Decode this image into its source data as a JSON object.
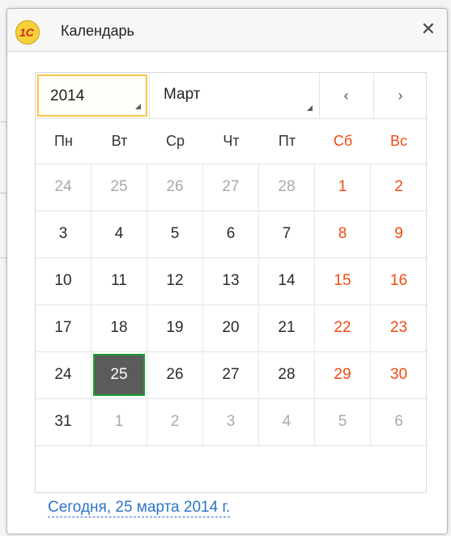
{
  "window": {
    "title": "Календарь",
    "close_symbol": "✕",
    "logo_text": "1C"
  },
  "calendar": {
    "year": "2014",
    "month": "Март",
    "prev_symbol": "‹",
    "next_symbol": "›",
    "weekdays": [
      {
        "label": "Пн",
        "weekend": false
      },
      {
        "label": "Вт",
        "weekend": false
      },
      {
        "label": "Ср",
        "weekend": false
      },
      {
        "label": "Чт",
        "weekend": false
      },
      {
        "label": "Пт",
        "weekend": false
      },
      {
        "label": "Сб",
        "weekend": true
      },
      {
        "label": "Вс",
        "weekend": true
      }
    ],
    "weeks": [
      [
        {
          "d": "24",
          "o": true
        },
        {
          "d": "25",
          "o": true
        },
        {
          "d": "26",
          "o": true
        },
        {
          "d": "27",
          "o": true
        },
        {
          "d": "28",
          "o": true
        },
        {
          "d": "1",
          "w": true
        },
        {
          "d": "2",
          "w": true
        }
      ],
      [
        {
          "d": "3"
        },
        {
          "d": "4"
        },
        {
          "d": "5"
        },
        {
          "d": "6"
        },
        {
          "d": "7"
        },
        {
          "d": "8",
          "w": true
        },
        {
          "d": "9",
          "w": true
        }
      ],
      [
        {
          "d": "10"
        },
        {
          "d": "11"
        },
        {
          "d": "12"
        },
        {
          "d": "13"
        },
        {
          "d": "14"
        },
        {
          "d": "15",
          "w": true
        },
        {
          "d": "16",
          "w": true
        }
      ],
      [
        {
          "d": "17"
        },
        {
          "d": "18"
        },
        {
          "d": "19"
        },
        {
          "d": "20"
        },
        {
          "d": "21"
        },
        {
          "d": "22",
          "w": true
        },
        {
          "d": "23",
          "w": true
        }
      ],
      [
        {
          "d": "24"
        },
        {
          "d": "25",
          "s": true
        },
        {
          "d": "26"
        },
        {
          "d": "27"
        },
        {
          "d": "28"
        },
        {
          "d": "29",
          "w": true
        },
        {
          "d": "30",
          "w": true
        }
      ],
      [
        {
          "d": "31"
        },
        {
          "d": "1",
          "o": true
        },
        {
          "d": "2",
          "o": true
        },
        {
          "d": "3",
          "o": true
        },
        {
          "d": "4",
          "o": true
        },
        {
          "d": "5",
          "o": true
        },
        {
          "d": "6",
          "o": true
        }
      ]
    ],
    "today_link": "Сегодня, 25 марта 2014 г."
  },
  "colors": {
    "weekend": "#f04a12",
    "selected_bg": "#5b5b5b",
    "selected_border": "#1aa32f",
    "link": "#2e74c7",
    "year_focus": "#f4c84b"
  }
}
